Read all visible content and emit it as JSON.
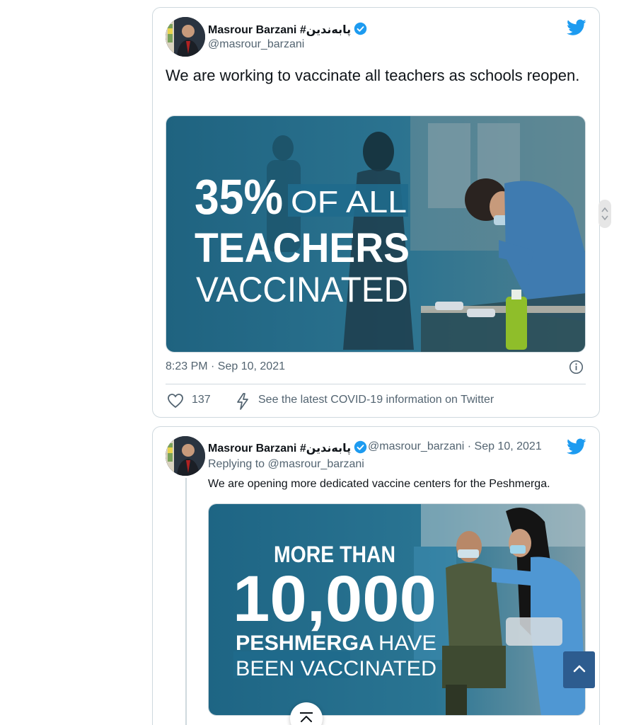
{
  "tweet1": {
    "author_name": "Masrour Barzani #پابەندین",
    "author_handle": "@masrour_barzani",
    "text": "We are working to vaccinate all teachers as schools reopen.",
    "media": {
      "big_number": "35%",
      "line1_rest": "OF ALL",
      "line2": "TEACHERS",
      "line3": "VACCINATED"
    },
    "timestamp": "8:23 PM · Sep 10, 2021",
    "like_count": "137",
    "covid_link": "See the latest COVID-19 information on Twitter"
  },
  "tweet2": {
    "author_name": "Masrour Barzani #پابەندین",
    "handle_date": "@masrour_barzani · Sep 10, 2021",
    "replying_to": "Replying to @masrour_barzani",
    "text": "We are opening more dedicated vaccine centers for the Peshmerga.",
    "media": {
      "line1": "MORE THAN",
      "big_number": "10,000",
      "line3_bold": "PESHMERGA",
      "line3_rest": "HAVE",
      "line4": "BEEN VACCINATED"
    }
  },
  "colors": {
    "twitter_blue": "#1d9bf0",
    "media_teal": "#2b6e8a",
    "back_to_top": "#2d5c8f"
  },
  "icons": {
    "verified": "verified-badge-icon",
    "bird": "twitter-bird-icon",
    "info": "info-icon",
    "like": "heart-icon",
    "covid": "lightning-icon",
    "to_top": "chevron-up-icon",
    "collapse": "collapse-up-icon"
  }
}
